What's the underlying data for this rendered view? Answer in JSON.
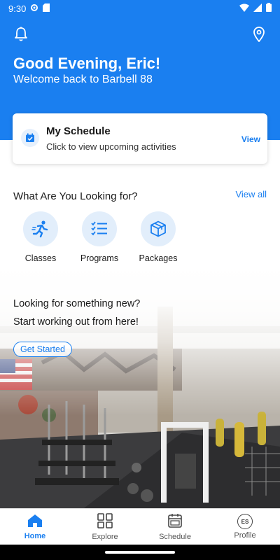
{
  "status": {
    "time": "9:30",
    "icons_left": [
      "settings-icon",
      "sd-card-icon"
    ],
    "icons_right": [
      "wifi-icon",
      "signal-icon",
      "battery-icon"
    ]
  },
  "header": {
    "greeting": "Good Evening, Eric!",
    "welcome": "Welcome back to Barbell 88",
    "brand_color": "#1a7ff0"
  },
  "schedule_card": {
    "title": "My Schedule",
    "subtitle": "Click to view upcoming activities",
    "action": "View"
  },
  "explore": {
    "title": "What Are You Looking for?",
    "view_all": "View all",
    "categories": [
      {
        "label": "Classes",
        "icon": "runner-icon"
      },
      {
        "label": "Programs",
        "icon": "checklist-icon"
      },
      {
        "label": "Packages",
        "icon": "box-icon"
      }
    ]
  },
  "promo": {
    "line1": "Looking for something new?",
    "line2": "Start working out from here!",
    "cta": "Get Started"
  },
  "bottom_nav": {
    "items": [
      {
        "label": "Home",
        "icon": "home-icon",
        "active": true
      },
      {
        "label": "Explore",
        "icon": "grid-icon",
        "active": false
      },
      {
        "label": "Schedule",
        "icon": "calendar-icon",
        "active": false
      },
      {
        "label": "Profile",
        "icon": "avatar-initials",
        "active": false
      }
    ],
    "profile_initials": "ES"
  }
}
